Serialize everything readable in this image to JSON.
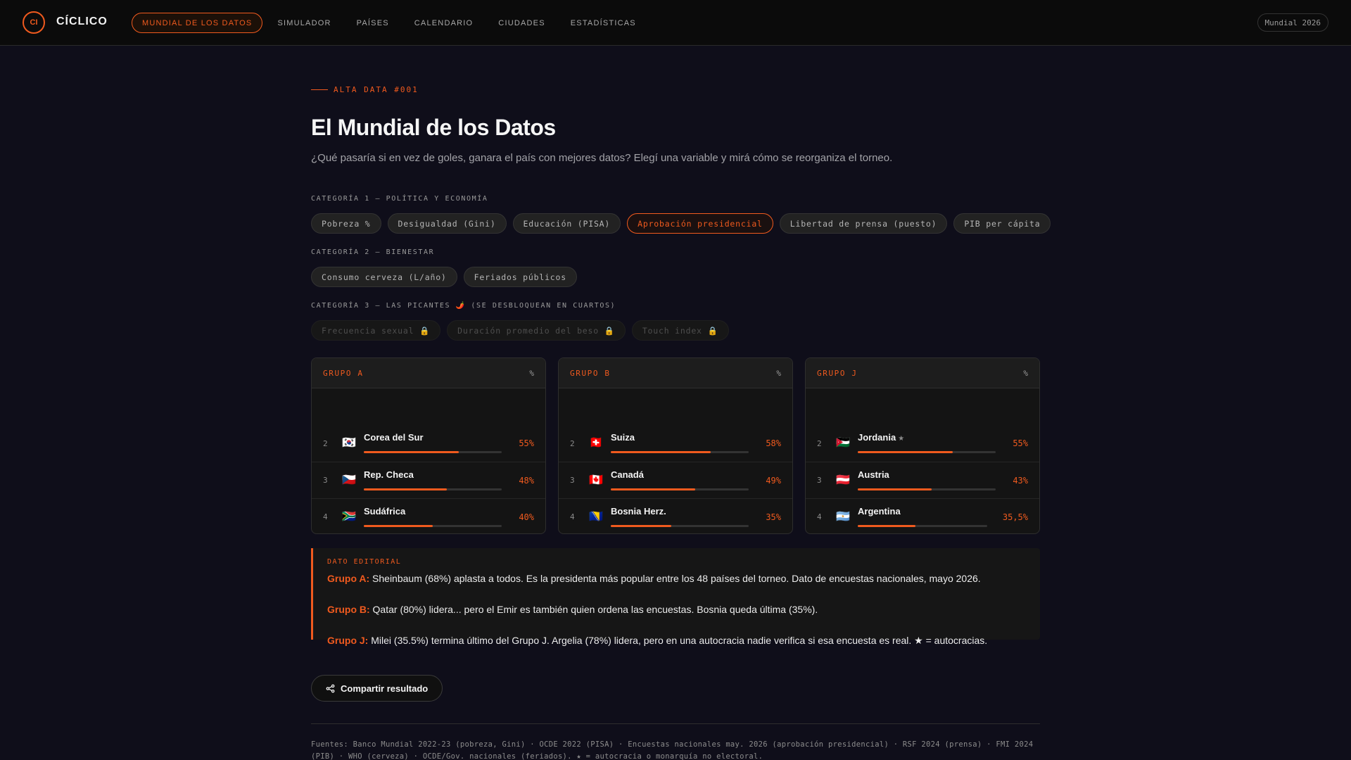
{
  "header": {
    "logo_initials": "CI",
    "brand": "CÍCLICO",
    "nav": [
      {
        "label": "MUNDIAL DE LOS DATOS",
        "active": true
      },
      {
        "label": "SIMULADOR",
        "active": false
      },
      {
        "label": "PAÍSES",
        "active": false
      },
      {
        "label": "CALENDARIO",
        "active": false
      },
      {
        "label": "CIUDADES",
        "active": false
      },
      {
        "label": "ESTADÍSTICAS",
        "active": false
      }
    ],
    "badge": "Mundial 2026"
  },
  "hero": {
    "eyebrow": "ALTA DATA #001",
    "title": "El Mundial de los Datos",
    "subtitle": "¿Qué pasaría si en vez de goles, ganara el país con mejores datos? Elegí una variable y mirá cómo se reorganiza el torneo."
  },
  "categories": [
    {
      "label": "CATEGORÍA 1 — POLÍTICA Y ECONOMÍA",
      "chips": [
        {
          "label": "Pobreza %",
          "state": "normal"
        },
        {
          "label": "Desigualdad (Gini)",
          "state": "normal"
        },
        {
          "label": "Educación (PISA)",
          "state": "normal"
        },
        {
          "label": "Aprobación presidencial",
          "state": "active"
        },
        {
          "label": "Libertad de prensa (puesto)",
          "state": "normal"
        },
        {
          "label": "PIB per cápita",
          "state": "normal"
        }
      ]
    },
    {
      "label": "CATEGORÍA 2 — BIENESTAR",
      "chips": [
        {
          "label": "Consumo cerveza (L/año)",
          "state": "normal"
        },
        {
          "label": "Feriados públicos",
          "state": "normal"
        }
      ]
    },
    {
      "label": "CATEGORÍA 3 — LAS PICANTES 🌶️ (SE DESBLOQUEAN EN CUARTOS)",
      "chips": [
        {
          "label": "Frecuencia sexual 🔒",
          "state": "locked"
        },
        {
          "label": "Duración promedio del beso 🔒",
          "state": "locked"
        },
        {
          "label": "Touch index 🔒",
          "state": "locked"
        }
      ]
    }
  ],
  "groups": [
    {
      "name": "GRUPO A",
      "unit": "%",
      "rows": [
        {
          "rank": "2",
          "flag": "🇰🇷",
          "country": "Corea del Sur",
          "star": "",
          "value": "55%",
          "pct": 55
        },
        {
          "rank": "3",
          "flag": "🇨🇿",
          "country": "Rep. Checa",
          "star": "",
          "value": "48%",
          "pct": 48
        },
        {
          "rank": "4",
          "flag": "🇿🇦",
          "country": "Sudáfrica",
          "star": "",
          "value": "40%",
          "pct": 40
        }
      ]
    },
    {
      "name": "GRUPO B",
      "unit": "%",
      "rows": [
        {
          "rank": "2",
          "flag": "🇨🇭",
          "country": "Suiza",
          "star": "",
          "value": "58%",
          "pct": 58
        },
        {
          "rank": "3",
          "flag": "🇨🇦",
          "country": "Canadá",
          "star": "",
          "value": "49%",
          "pct": 49
        },
        {
          "rank": "4",
          "flag": "🇧🇦",
          "country": "Bosnia Herz.",
          "star": "",
          "value": "35%",
          "pct": 35
        }
      ]
    },
    {
      "name": "GRUPO J",
      "unit": "%",
      "rows": [
        {
          "rank": "2",
          "flag": "🇯🇴",
          "country": "Jordania",
          "star": "★",
          "value": "55%",
          "pct": 55
        },
        {
          "rank": "3",
          "flag": "🇦🇹",
          "country": "Austria",
          "star": "",
          "value": "43%",
          "pct": 43
        },
        {
          "rank": "4",
          "flag": "🇦🇷",
          "country": "Argentina",
          "star": "",
          "value": "35,5%",
          "pct": 35.5
        }
      ]
    }
  ],
  "editorial": {
    "label": "DATO EDITORIAL",
    "items": [
      {
        "group": "Grupo A:",
        "text": " Sheinbaum (68%) aplasta a todos. Es la presidenta más popular entre los 48 países del torneo. Dato de encuestas nacionales, mayo 2026."
      },
      {
        "group": "Grupo B:",
        "text": " Qatar (80%) lidera... pero el Emir es también quien ordena las encuestas. Bosnia queda última (35%)."
      },
      {
        "group": "Grupo J:",
        "text": " Milei (35.5%) termina último del Grupo J. Argelia (78%) lidera, pero en una autocracia nadie verifica si esa encuesta es real. ★ = autocracias."
      }
    ]
  },
  "share_label": "Compartir resultado",
  "sources": "Fuentes: Banco Mundial 2022-23 (pobreza, Gini) · OCDE 2022 (PISA) · Encuestas nacionales may. 2026 (aprobación presidencial) · RSF 2024 (prensa) · FMI 2024 (PIB) · WHO (cerveza) · OCDE/Gov. nacionales (feriados). ★ = autocracia o monarquía no electoral.",
  "colors": {
    "accent": "#f05a1e",
    "background": "#0f0e1a"
  }
}
